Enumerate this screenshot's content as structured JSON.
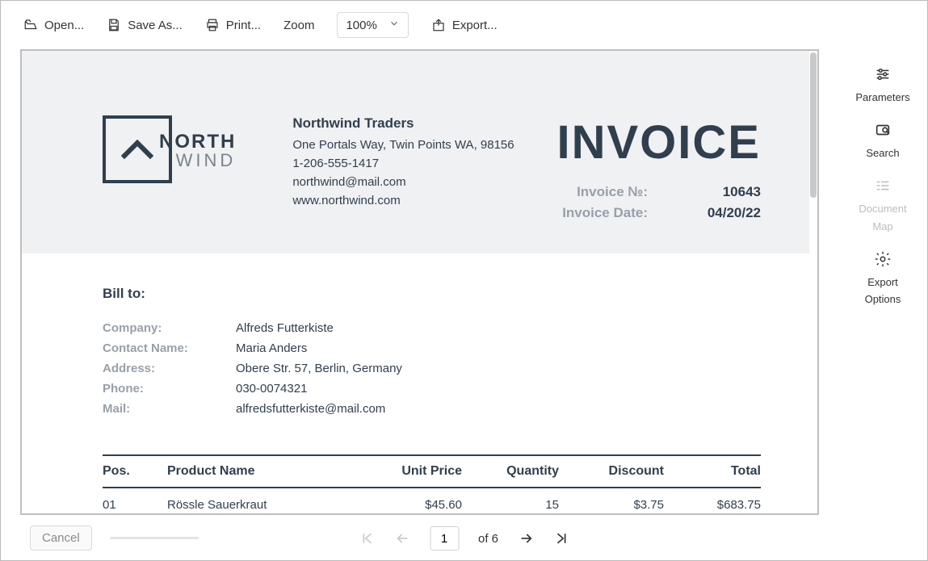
{
  "toolbar": {
    "open_label": "Open...",
    "save_as_label": "Save As...",
    "print_label": "Print...",
    "zoom_label": "Zoom",
    "zoom_value": "100%",
    "export_label": "Export..."
  },
  "side": {
    "parameters_label": "Parameters",
    "search_label": "Search",
    "document_map_label_1": "Document",
    "document_map_label_2": "Map",
    "export_options_label_1": "Export",
    "export_options_label_2": "Options"
  },
  "company": {
    "name": "Northwind Traders",
    "address": "One Portals Way, Twin Points WA, 98156",
    "phone": "1-206-555-1417",
    "mail": "northwind@mail.com",
    "web": "www.northwind.com",
    "logo_line1": "NORTH",
    "logo_line2": "WIND"
  },
  "invoice": {
    "title": "INVOICE",
    "no_label": "Invoice №:",
    "no_value": "10643",
    "date_label": "Invoice Date:",
    "date_value": "04/20/22"
  },
  "billto": {
    "heading": "Bill to:",
    "labels": {
      "company": "Company:",
      "contact": "Contact Name:",
      "address": "Address:",
      "phone": "Phone:",
      "mail": "Mail:"
    },
    "values": {
      "company": "Alfreds Futterkiste",
      "contact": "Maria Anders",
      "address": "Obere Str. 57, Berlin, Germany",
      "phone": "030-0074321",
      "mail": "alfredsfutterkiste@mail.com"
    }
  },
  "items": {
    "headers": {
      "pos": "Pos.",
      "product": "Product Name",
      "unit_price": "Unit Price",
      "qty": "Quantity",
      "discount": "Discount",
      "total": "Total"
    },
    "rows": [
      {
        "pos": "01",
        "product": "Rössle Sauerkraut",
        "unit_price": "$45.60",
        "qty": "15",
        "discount": "$3.75",
        "total": "$683.75"
      }
    ]
  },
  "pager": {
    "cancel_label": "Cancel",
    "current": "1",
    "of_label": "of 6"
  }
}
